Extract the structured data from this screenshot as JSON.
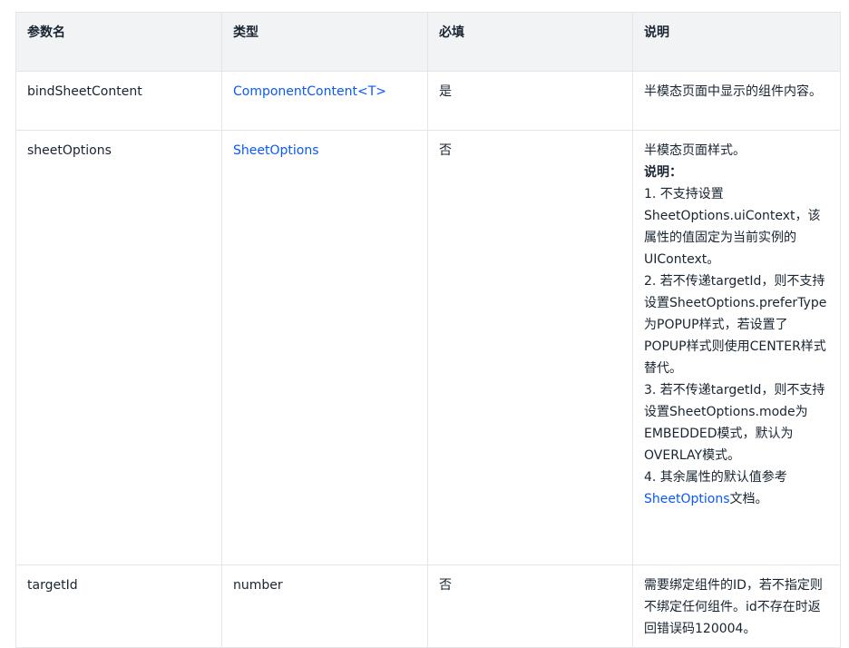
{
  "table": {
    "headers": [
      "参数名",
      "类型",
      "必填",
      "说明"
    ],
    "rows": [
      {
        "name": "bindSheetContent",
        "type": "ComponentContent<T>",
        "required": "是",
        "description": "半模态页面中显示的组件内容。"
      },
      {
        "name": "sheetOptions",
        "type": "SheetOptions",
        "required": "否",
        "description": "半模态页面样式。",
        "note_title": "说明：",
        "notes": [
          "1. 不支持设置SheetOptions.uiContext，该属性的值固定为当前实例的UIContext。",
          "2. 若不传递targetId，则不支持设置SheetOptions.preferType为POPUP样式，若设置了POPUP样式则使用CENTER样式替代。",
          "3. 若不传递targetId，则不支持设置SheetOptions.mode为EMBEDDED模式，默认为OVERLAY模式。"
        ],
        "note4_prefix": "4. 其余属性的默认值参考",
        "note4_link": "SheetOptions",
        "note4_suffix": "文档。"
      },
      {
        "name": "targetId",
        "type": "number",
        "required": "否",
        "description": "需要绑定组件的ID，若不指定则不绑定任何组件。id不存在时返回错误码120004。"
      }
    ]
  },
  "colors": {
    "link": "#0a59f7",
    "header_bg": "#f1f3f5",
    "border": "#e3e5e8",
    "text": "#182431"
  }
}
